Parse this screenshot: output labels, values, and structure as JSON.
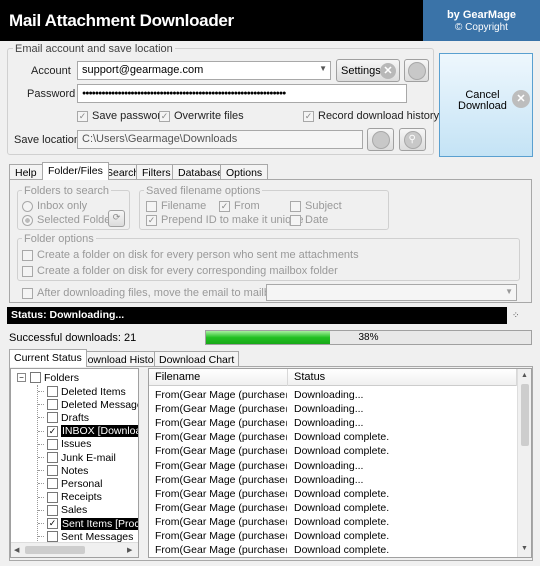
{
  "app": {
    "title": "Mail Attachment Downloader",
    "brand_line1": "by GearMage",
    "brand_line2": "© Copyright"
  },
  "account_group": {
    "title": "Email account and save location",
    "account_label": "Account",
    "account_value": "support@gearmage.com",
    "settings_label": "Settings",
    "password_label": "Password",
    "password_value": "●●●●●●●●●●●●●●●●●●●●●●●●●●●●●●●●●●●●●●●●●●●●●●●●●●●●●●●●●●●●●●●",
    "save_password": "Save password",
    "overwrite_files": "Overwrite files",
    "record_history": "Record download history",
    "save_location_label": "Save location:",
    "save_location_value": "C:\\Users\\Gearmage\\Downloads"
  },
  "cancel_button": {
    "line1": "Cancel",
    "line2": "Download"
  },
  "tabs": [
    "Help",
    "Folder/Files",
    "Search",
    "Filters",
    "Database",
    "Options"
  ],
  "folder_files": {
    "folders_group": "Folders to search",
    "inbox_only": "Inbox only",
    "selected_folders": "Selected Folders",
    "saved_group": "Saved filename options",
    "filename": "Filename",
    "from": "From",
    "subject": "Subject",
    "prepend": "Prepend ID to make it unique",
    "date": "Date",
    "folder_options_group": "Folder options",
    "per_person": "Create a folder on disk for every person who sent me attachments",
    "per_mailbox": "Create a folder on disk for every corresponding mailbox folder",
    "move_after": "After downloading files, move the email to mailbox folder"
  },
  "status": {
    "text": "Status:  Downloading...",
    "successful": "Successful downloads: 21",
    "progress_percent": 38,
    "progress_label": "38%"
  },
  "bottom_tabs": [
    "Current Status",
    "Download History",
    "Download Chart"
  ],
  "tree": {
    "root": "Folders",
    "items": [
      {
        "label": "Deleted Items",
        "checked": false,
        "selected": false
      },
      {
        "label": "Deleted Messages",
        "checked": false,
        "selected": false
      },
      {
        "label": "Drafts",
        "checked": false,
        "selected": false
      },
      {
        "label": "INBOX [Downloading]",
        "checked": true,
        "selected": true
      },
      {
        "label": "Issues",
        "checked": false,
        "selected": false
      },
      {
        "label": "Junk E-mail",
        "checked": false,
        "selected": false
      },
      {
        "label": "Notes",
        "checked": false,
        "selected": false
      },
      {
        "label": "Personal",
        "checked": false,
        "selected": false
      },
      {
        "label": "Receipts",
        "checked": false,
        "selected": false
      },
      {
        "label": "Sales",
        "checked": false,
        "selected": false
      },
      {
        "label": "Sent Items [Processed]",
        "checked": true,
        "selected": true
      },
      {
        "label": "Sent Messages",
        "checked": false,
        "selected": false
      }
    ]
  },
  "grid": {
    "columns": [
      "Filename",
      "Status"
    ],
    "rows": [
      [
        "From(Gear Mage (purchase@g...",
        "Downloading..."
      ],
      [
        "From(Gear Mage (purchase@g...",
        "Downloading..."
      ],
      [
        "From(Gear Mage (purchase@g...",
        "Downloading..."
      ],
      [
        "From(Gear Mage (purchase@g...",
        "Download complete."
      ],
      [
        "From(Gear Mage (purchase@g...",
        "Download complete."
      ],
      [
        "From(Gear Mage (purchase@g...",
        "Downloading..."
      ],
      [
        "From(Gear Mage (purchase@g...",
        "Downloading..."
      ],
      [
        "From(Gear Mage (purchase@g...",
        "Download complete."
      ],
      [
        "From(Gear Mage (purchase@g...",
        "Download complete."
      ],
      [
        "From(Gear Mage (purchase@g...",
        "Download complete."
      ],
      [
        "From(Gear Mage (purchase@g...",
        "Download complete."
      ],
      [
        "From(Gear Mage (purchase@g...",
        "Download complete."
      ]
    ]
  },
  "colors": {
    "brand": "#3a73a8",
    "progress": "#22c022"
  }
}
